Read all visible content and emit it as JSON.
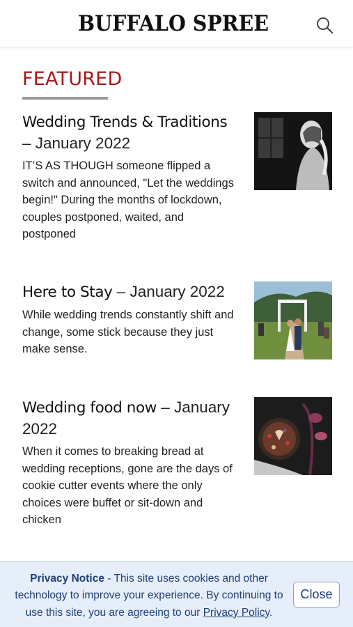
{
  "header": {
    "logo_text": "BUFFALO SPREE",
    "search_icon": "search-icon"
  },
  "featured": {
    "title": "FEATURED",
    "articles": [
      {
        "title": "Wedding Trends & Traditions",
        "date_suffix": " – January 2022",
        "excerpt": "IT’S AS THOUGH someone flipped a switch and announced, \"Let the weddings begin!\" During the months of lockdown, couples postponed, waited, and postponed"
      },
      {
        "title": "Here to Stay",
        "date_suffix": " – January 2022",
        "excerpt": "While wedding trends constantly shift and change, some stick because they just make sense."
      },
      {
        "title": "Wedding food now",
        "date_suffix": " – January 2022",
        "excerpt": "When it comes to breaking bread at wedding receptions, gone are the days of cookie cutter events where the only choices were buffet or sit-down and chicken"
      }
    ]
  },
  "privacy": {
    "label": "Privacy Notice",
    "text": " - This site uses cookies and other technology to improve your experience. By continuing to use this site, you are agreeing to our ",
    "link": "Privacy Policy",
    "end": ".",
    "close_label": "Close"
  }
}
